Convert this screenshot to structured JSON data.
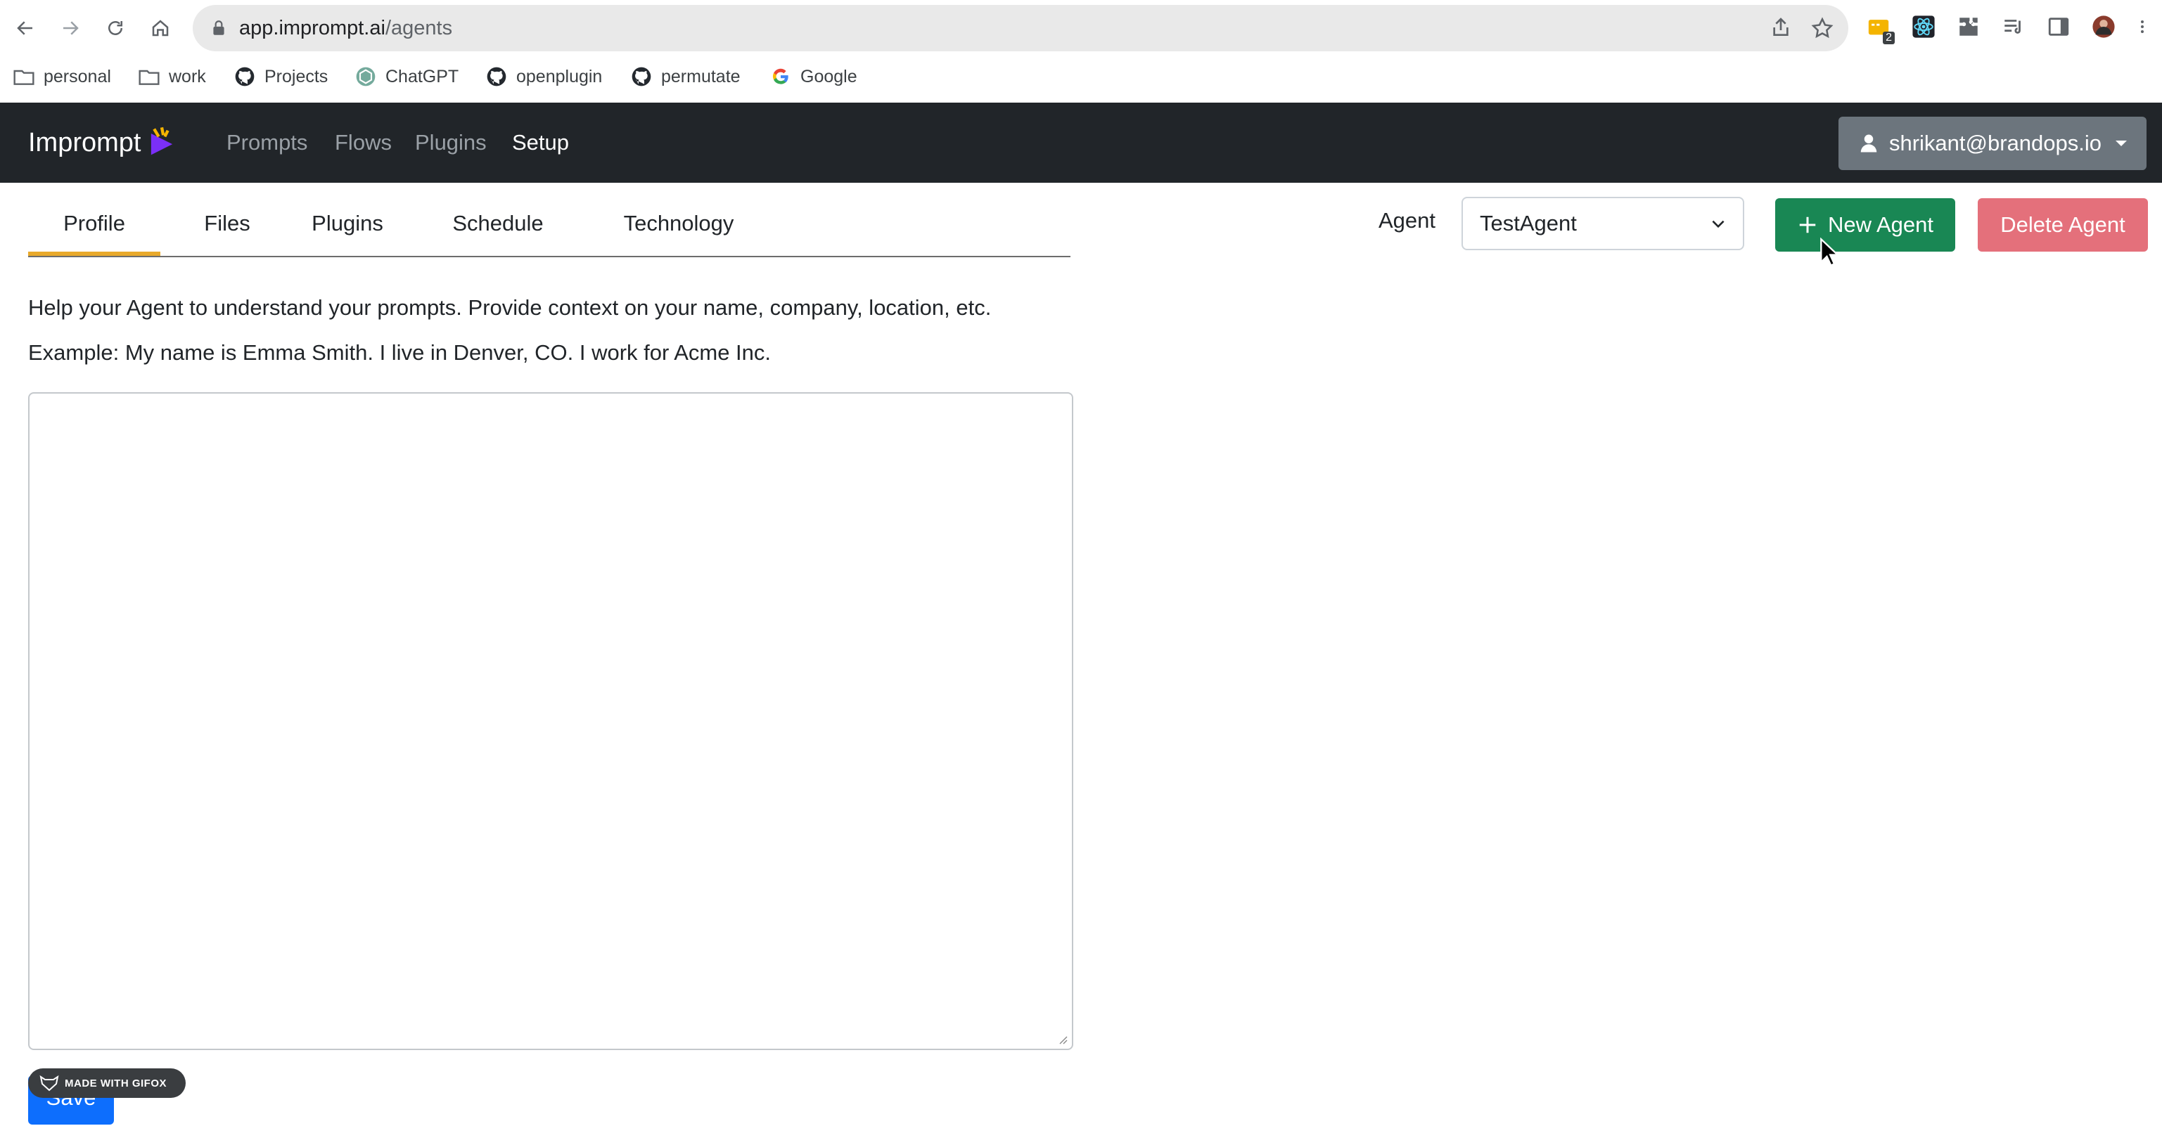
{
  "browser": {
    "url_host": "app.imprompt.ai",
    "url_path": "/agents",
    "extension_badge": "2",
    "bookmarks": [
      {
        "label": "personal",
        "icon": "folder-icon"
      },
      {
        "label": "work",
        "icon": "folder-icon"
      },
      {
        "label": "Projects",
        "icon": "github-icon"
      },
      {
        "label": "ChatGPT",
        "icon": "openai-icon"
      },
      {
        "label": "openplugin",
        "icon": "github-icon"
      },
      {
        "label": "permutate",
        "icon": "github-icon"
      },
      {
        "label": "Google",
        "icon": "google-icon"
      }
    ]
  },
  "app": {
    "brand": "Imprompt",
    "nav": [
      {
        "label": "Prompts",
        "active": false
      },
      {
        "label": "Flows",
        "active": false
      },
      {
        "label": "Plugins",
        "active": false
      },
      {
        "label": "Setup",
        "active": true
      }
    ],
    "user_email": "shrikant@brandops.io"
  },
  "tabs": [
    {
      "label": "Profile",
      "active": true
    },
    {
      "label": "Files",
      "active": false
    },
    {
      "label": "Plugins",
      "active": false
    },
    {
      "label": "Schedule",
      "active": false
    },
    {
      "label": "Technology",
      "active": false
    }
  ],
  "agent": {
    "label": "Agent",
    "selected": "TestAgent",
    "new_button": "New Agent",
    "delete_button": "Delete Agent"
  },
  "profile": {
    "help_text": "Help your Agent to understand your prompts. Provide context on your name, company, location, etc.",
    "example_text": "Example: My name is Emma Smith. I live in Denver, CO. I work for Acme Inc.",
    "textarea_value": "",
    "save_button": "Save"
  },
  "overlay": {
    "gifox_label": "MADE WITH GIFOX"
  },
  "colors": {
    "navbar": "#212529",
    "tab_accent": "#e8a92b",
    "new_button": "#198754",
    "delete_button": "#e4707b",
    "save_button": "#0d6efd",
    "user_button": "#6c757d"
  }
}
